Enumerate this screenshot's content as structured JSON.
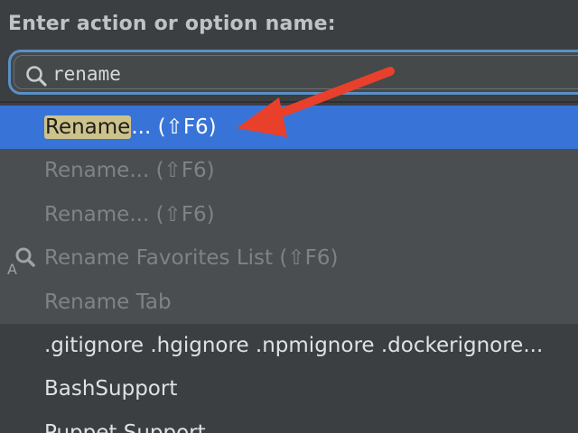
{
  "popup": {
    "prompt": "Enter action or option name:",
    "search": {
      "value": "rename",
      "icon": "search-icon"
    }
  },
  "results": [
    {
      "match": "Rename",
      "rest": "... (⇧F6)",
      "state": "selected"
    },
    {
      "match": "",
      "rest": "Rename... (⇧F6)",
      "state": "disabled"
    },
    {
      "match": "",
      "rest": "Rename... (⇧F6)",
      "state": "disabled"
    },
    {
      "match": "",
      "rest": "Rename Favorites List (⇧F6)",
      "state": "disabled",
      "icon": "find-action-icon"
    },
    {
      "match": "",
      "rest": "Rename Tab",
      "state": "disabled"
    },
    {
      "match": "",
      "rest": ".gitignore .hgignore .npmignore .dockerignore...",
      "state": "normal"
    },
    {
      "match": "",
      "rest": "BashSupport",
      "state": "normal"
    },
    {
      "match": "",
      "rest": "Puppet Support",
      "state": "normal"
    }
  ],
  "colors": {
    "background": "#3c3f41",
    "selection": "#3874d8",
    "match_highlight": "#cdc28a",
    "focus_ring": "#5b8fc6",
    "annotation_arrow": "#e8402b"
  }
}
